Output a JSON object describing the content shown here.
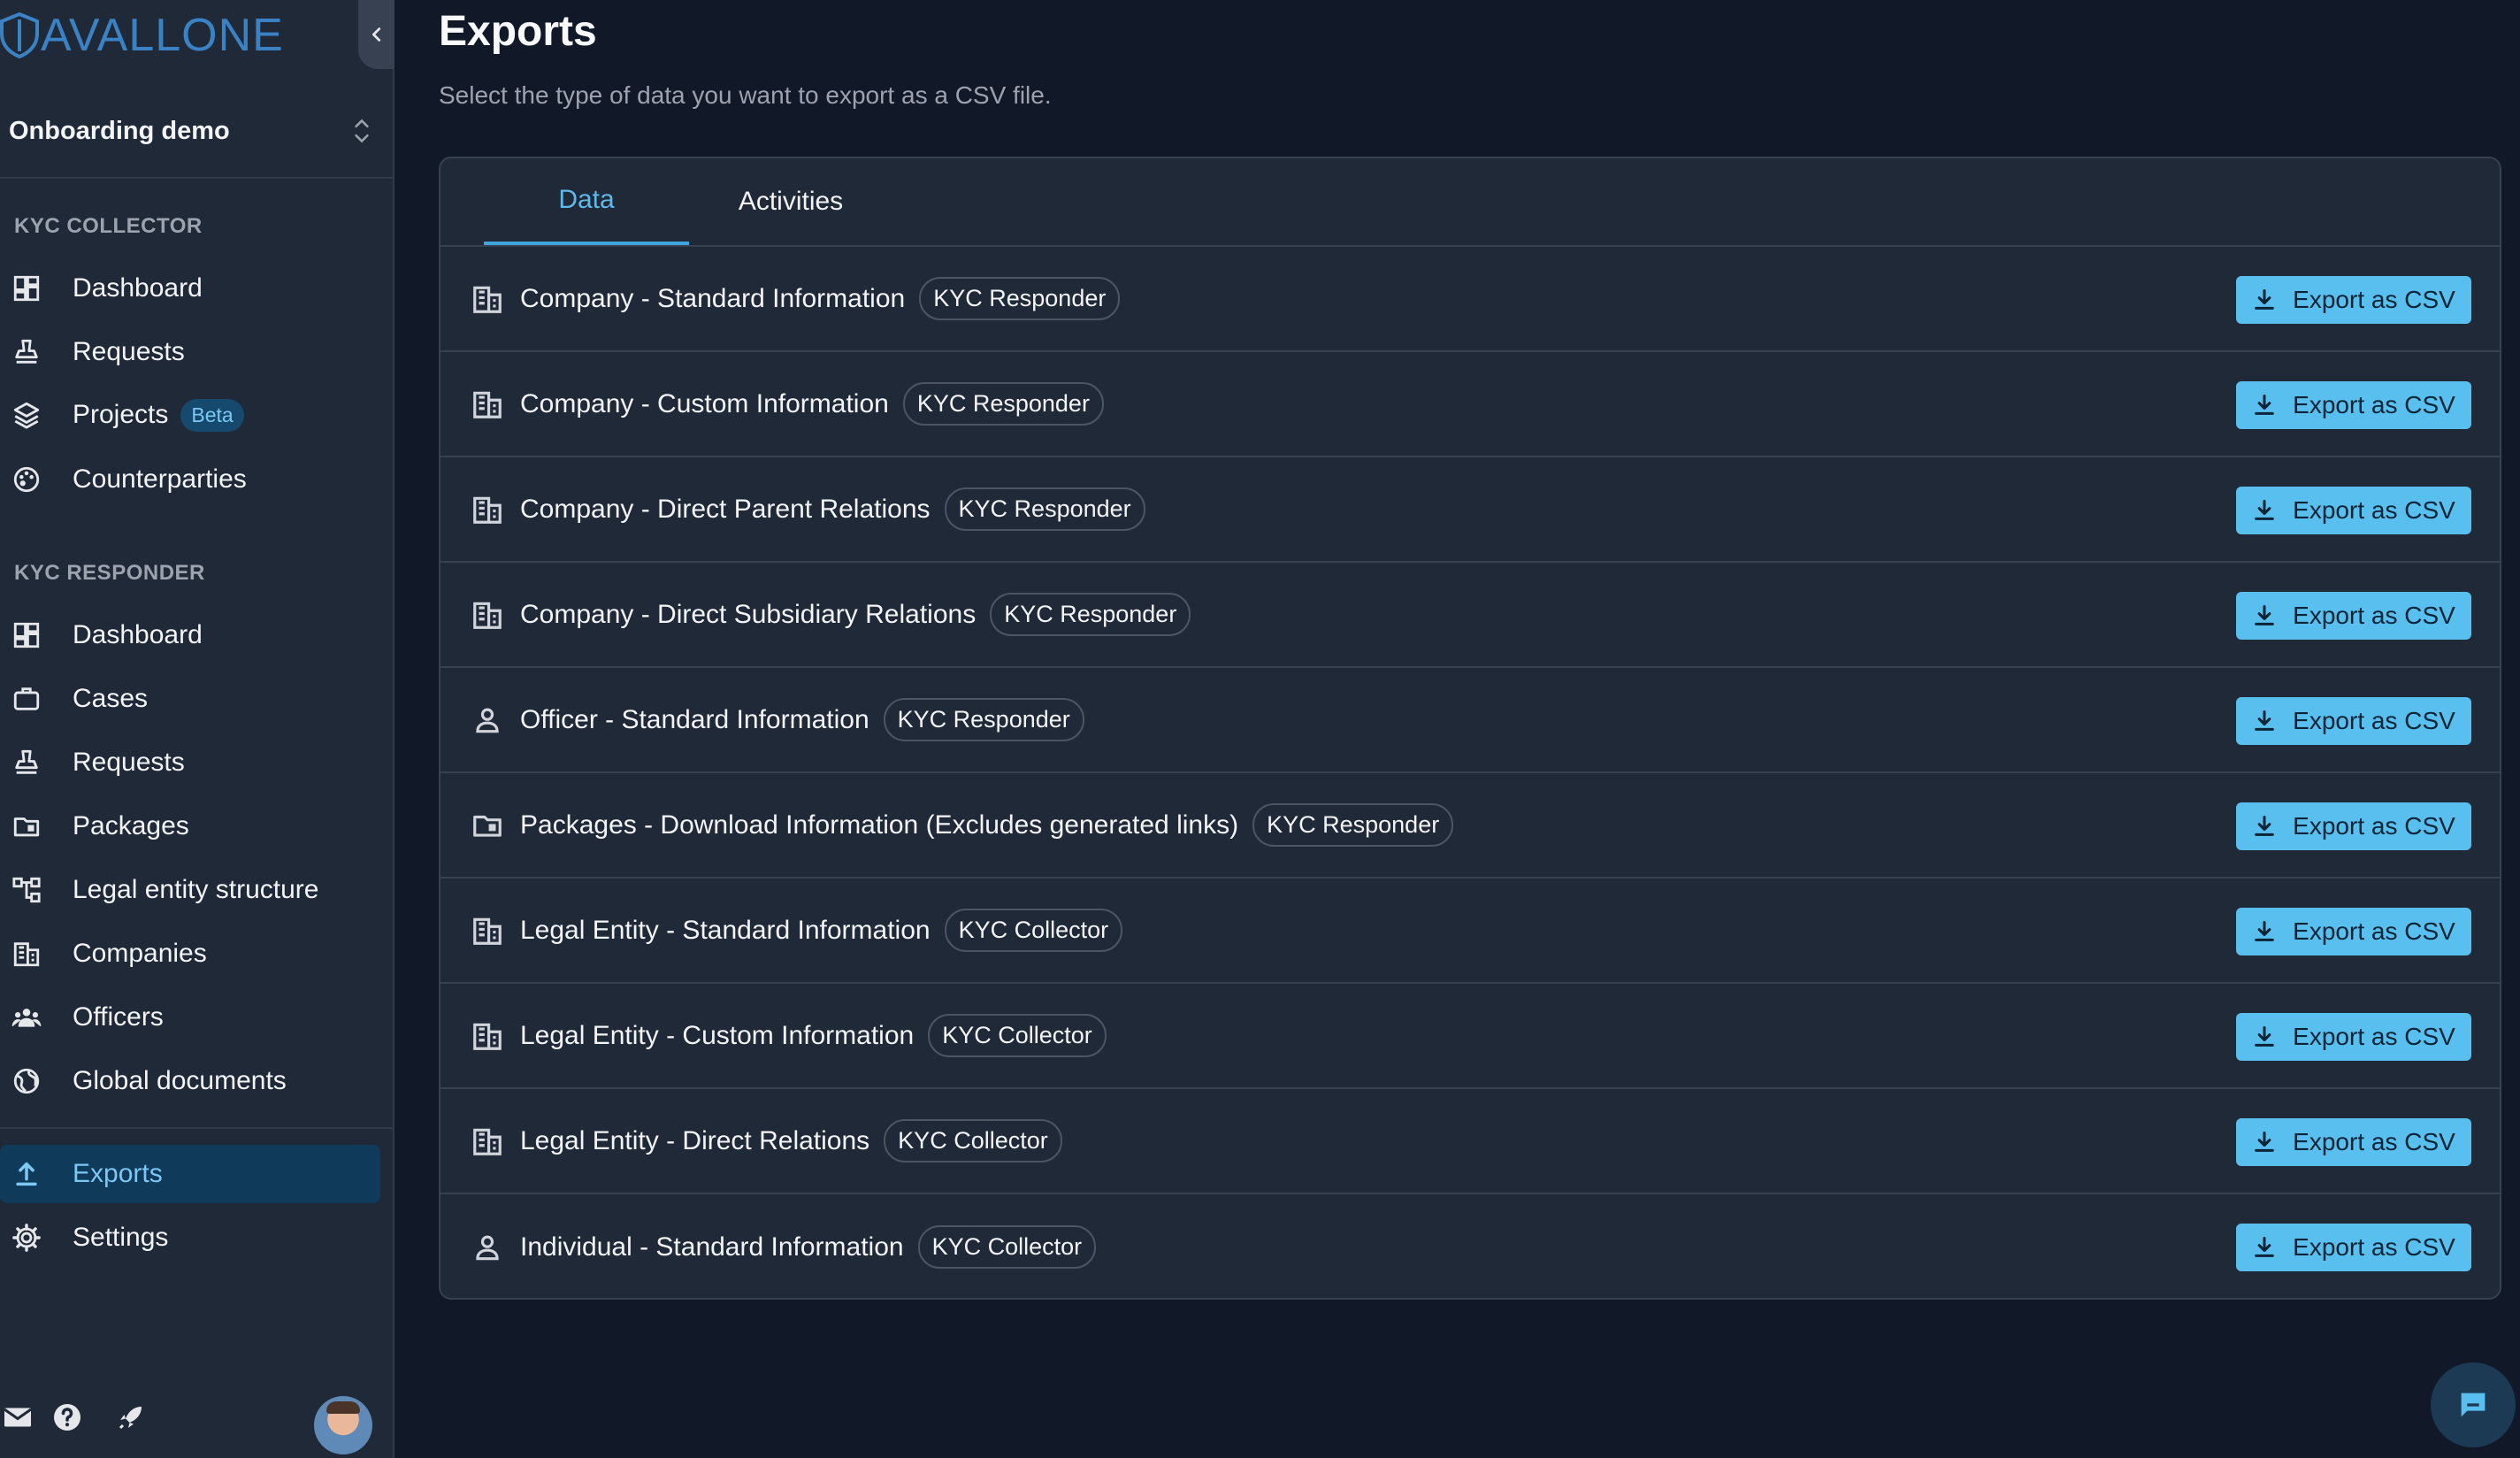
{
  "app": {
    "logo_text": "AVALLONE"
  },
  "org": {
    "name": "Onboarding demo"
  },
  "sidebar": {
    "collector_title": "KYC COLLECTOR",
    "collector_items": [
      {
        "label": "Dashboard",
        "icon": "dashboard-icon"
      },
      {
        "label": "Requests",
        "icon": "stamp-icon"
      },
      {
        "label": "Projects",
        "icon": "layers-icon",
        "badge": "Beta"
      },
      {
        "label": "Counterparties",
        "icon": "palette-icon"
      }
    ],
    "responder_title": "KYC RESPONDER",
    "responder_items": [
      {
        "label": "Dashboard",
        "icon": "dashboard-icon"
      },
      {
        "label": "Cases",
        "icon": "briefcase-icon"
      },
      {
        "label": "Requests",
        "icon": "stamp-icon"
      },
      {
        "label": "Packages",
        "icon": "folder-icon"
      },
      {
        "label": "Legal entity structure",
        "icon": "hierarchy-icon"
      },
      {
        "label": "Companies",
        "icon": "building-icon"
      },
      {
        "label": "Officers",
        "icon": "people-icon"
      },
      {
        "label": "Global documents",
        "icon": "globe-icon"
      }
    ],
    "bottom_items": [
      {
        "label": "Exports",
        "icon": "upload-icon",
        "active": true
      },
      {
        "label": "Settings",
        "icon": "gear-icon"
      }
    ]
  },
  "page": {
    "title": "Exports",
    "subtitle": "Select the type of data you want to export as a CSV file."
  },
  "tabs": [
    {
      "label": "Data",
      "active": true
    },
    {
      "label": "Activities",
      "active": false
    }
  ],
  "export_button_label": "Export as CSV",
  "exports": [
    {
      "name": "Company - Standard Information",
      "tag": "KYC Responder",
      "icon": "building-icon"
    },
    {
      "name": "Company - Custom Information",
      "tag": "KYC Responder",
      "icon": "building-icon"
    },
    {
      "name": "Company - Direct Parent Relations",
      "tag": "KYC Responder",
      "icon": "building-icon"
    },
    {
      "name": "Company - Direct Subsidiary Relations",
      "tag": "KYC Responder",
      "icon": "building-icon"
    },
    {
      "name": "Officer - Standard Information",
      "tag": "KYC Responder",
      "icon": "person-icon"
    },
    {
      "name": "Packages - Download Information (Excludes generated links)",
      "tag": "KYC Responder",
      "icon": "folder-icon"
    },
    {
      "name": "Legal Entity - Standard Information",
      "tag": "KYC Collector",
      "icon": "building-icon"
    },
    {
      "name": "Legal Entity - Custom Information",
      "tag": "KYC Collector",
      "icon": "building-icon"
    },
    {
      "name": "Legal Entity - Direct Relations",
      "tag": "KYC Collector",
      "icon": "building-icon"
    },
    {
      "name": "Individual - Standard Information",
      "tag": "KYC Collector",
      "icon": "person-icon"
    }
  ],
  "colors": {
    "accent": "#58bfee",
    "background": "#111827",
    "sidebar": "#1f2937"
  }
}
